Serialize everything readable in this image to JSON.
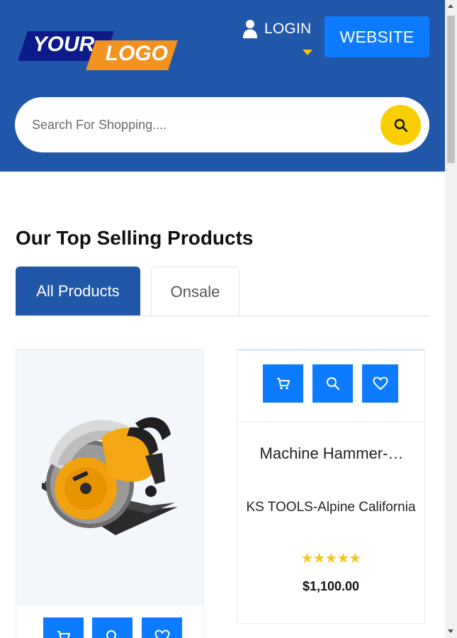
{
  "header": {
    "logo": {
      "word1": "YOUR",
      "word2": "LOGO"
    },
    "login_label": "LOGIN",
    "website_label": "WEBSITE",
    "colors": {
      "header_bg": "#2157a8",
      "accent_yellow": "#f9cf00",
      "button_blue": "#0d7bff",
      "logo_orange": "#f2921f",
      "logo_navy": "#0d1a8a"
    }
  },
  "search": {
    "placeholder": "Search For Shopping....",
    "icon": "search-icon"
  },
  "section": {
    "title": "Our Top Selling Products",
    "tabs": [
      {
        "label": "All Products",
        "active": true
      },
      {
        "label": "Onsale",
        "active": false
      }
    ]
  },
  "products": [
    {
      "image": "circular-saw",
      "actions": [
        "cart-icon",
        "search-icon",
        "heart-icon"
      ]
    },
    {
      "actions": [
        "cart-icon",
        "search-icon",
        "heart-icon"
      ],
      "name": "Machine Hammer-…",
      "brand": "KS TOOLS-Alpine California",
      "rating": 5,
      "stars": "★★★★★",
      "price": "$1,100.00"
    }
  ]
}
